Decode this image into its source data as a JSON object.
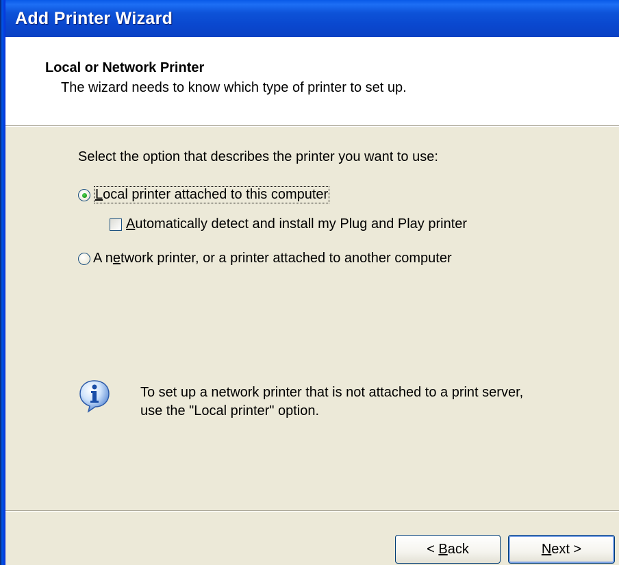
{
  "window": {
    "title": "Add Printer Wizard"
  },
  "header": {
    "title": "Local or Network Printer",
    "subtitle": "The wizard needs to know which type of printer to set up."
  },
  "body": {
    "prompt": "Select the option that describes the printer you want to use:",
    "options": [
      {
        "label": "Local printer attached to this computer",
        "mnemonic": "L",
        "selected": true
      },
      {
        "label": "A network printer, or a printer attached to another computer",
        "mnemonic": "e",
        "selected": false
      }
    ],
    "auto_detect": {
      "label": "Automatically detect and install my Plug and Play printer",
      "mnemonic": "A",
      "checked": false
    }
  },
  "info": {
    "icon": "info-icon",
    "line1": "To set up a network printer that is not attached to a print server,",
    "line2": "use the \"Local printer\" option."
  },
  "buttons": {
    "back": {
      "prefix": "< ",
      "mnemonic": "B",
      "rest": "ack"
    },
    "next": {
      "mnemonic": "N",
      "rest": "ext >"
    }
  },
  "colors": {
    "titlebar": "#0a48cf",
    "dialog_bg": "#ece9d8",
    "radio_dot": "#21a121"
  }
}
